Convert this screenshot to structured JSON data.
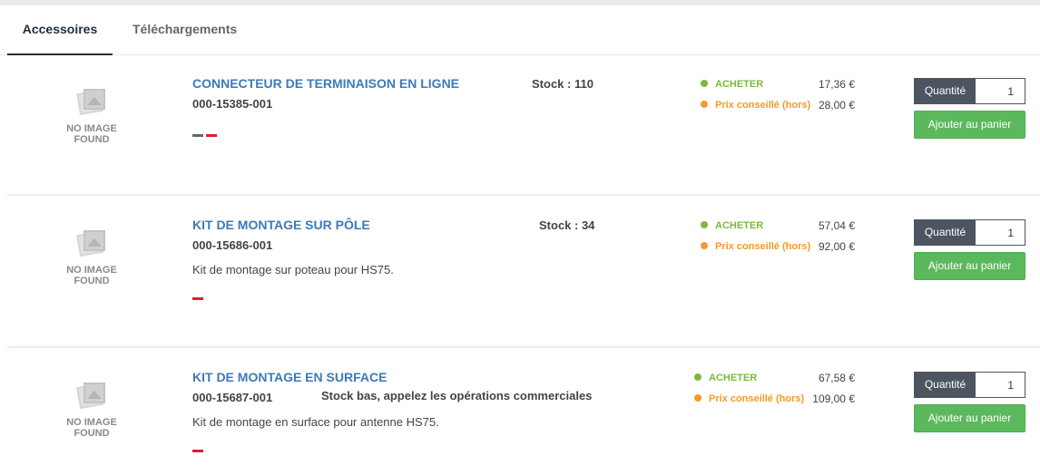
{
  "tabs": [
    {
      "label": "Accessoires",
      "active": true
    },
    {
      "label": "Téléchargements",
      "active": false
    }
  ],
  "no_image": {
    "line1": "NO IMAGE",
    "line2": "FOUND"
  },
  "labels": {
    "buy": "ACHETER",
    "msrp": "Prix conseillé (hors)",
    "quantity": "Quantité",
    "add_to_cart": "Ajouter au panier"
  },
  "colors": {
    "accent": "#3d7ab8",
    "buy": "#7db93a",
    "msrp": "#f39a2b",
    "cart_button": "#5cb85c",
    "qty_label": "#4d5560",
    "tag_red": "#d9232d",
    "tag_gray": "#666666"
  },
  "products": [
    {
      "title": "CONNECTEUR DE TERMINAISON EN LIGNE",
      "ref": "000-15385-001",
      "description": "",
      "stock": "Stock : 110",
      "buy_price": "17,36 €",
      "msrp_price": "28,00 €",
      "quantity": "1",
      "tags": [
        "gray",
        "red"
      ]
    },
    {
      "title": "KIT DE MONTAGE SUR PÔLE",
      "ref": "000-15686-001",
      "description": "Kit de montage sur poteau pour HS75.",
      "stock": "Stock : 34",
      "buy_price": "57,04 €",
      "msrp_price": "92,00 €",
      "quantity": "1",
      "tags": [
        "red"
      ]
    },
    {
      "title": "KIT DE MONTAGE EN SURFACE",
      "ref": "000-15687-001",
      "description": "Kit de montage en surface pour antenne HS75.",
      "stock": "Stock bas, appelez les opérations commerciales",
      "buy_price": "67,58 €",
      "msrp_price": "109,00 €",
      "quantity": "1",
      "tags": [
        "red"
      ]
    }
  ]
}
